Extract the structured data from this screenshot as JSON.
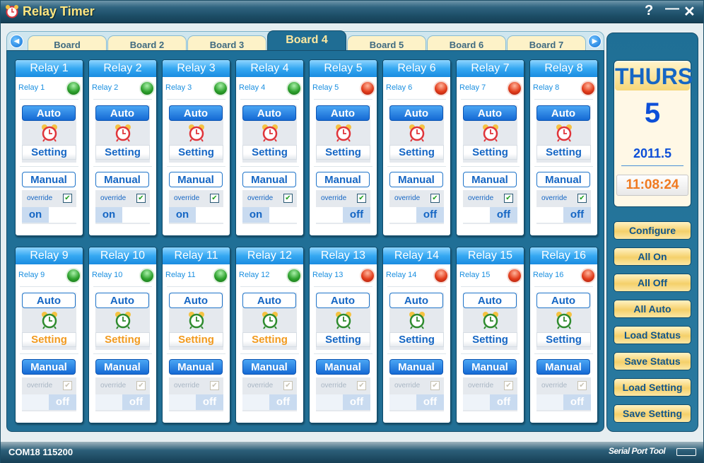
{
  "window": {
    "title": "Relay Timer",
    "controls": {
      "help": "?",
      "minimize": "—",
      "close": "✕"
    }
  },
  "tabs": {
    "prev_icon": "arrow-left-icon",
    "next_icon": "arrow-right-icon",
    "items": [
      {
        "label": "Board",
        "active": false
      },
      {
        "label": "Board 2",
        "active": false
      },
      {
        "label": "Board 3",
        "active": false
      },
      {
        "label": "Board 4",
        "active": true
      },
      {
        "label": "Board 5",
        "active": false
      },
      {
        "label": "Board 6",
        "active": false
      },
      {
        "label": "Board 7",
        "active": false
      }
    ]
  },
  "relays": [
    {
      "header": "Relay 1",
      "name": "Relay 1",
      "led": "green",
      "mode": "auto",
      "setting_color": "blue",
      "override": true,
      "state": "on"
    },
    {
      "header": "Relay 2",
      "name": "Relay 2",
      "led": "green",
      "mode": "auto",
      "setting_color": "blue",
      "override": true,
      "state": "on"
    },
    {
      "header": "Relay 3",
      "name": "Relay 3",
      "led": "green",
      "mode": "auto",
      "setting_color": "blue",
      "override": true,
      "state": "on"
    },
    {
      "header": "Relay 4",
      "name": "Relay 4",
      "led": "green",
      "mode": "auto",
      "setting_color": "blue",
      "override": true,
      "state": "on"
    },
    {
      "header": "Relay 5",
      "name": "Relay 5",
      "led": "red",
      "mode": "auto",
      "setting_color": "blue",
      "override": true,
      "state": "off"
    },
    {
      "header": "Relay 6",
      "name": "Relay 6",
      "led": "red",
      "mode": "auto",
      "setting_color": "blue",
      "override": true,
      "state": "off"
    },
    {
      "header": "Relay 7",
      "name": "Relay 7",
      "led": "red",
      "mode": "auto",
      "setting_color": "blue",
      "override": true,
      "state": "off"
    },
    {
      "header": "Relay 8",
      "name": "Relay 8",
      "led": "red",
      "mode": "auto",
      "setting_color": "blue",
      "override": true,
      "state": "off"
    },
    {
      "header": "Relay 9",
      "name": "Relay 9",
      "led": "green",
      "mode": "manual",
      "setting_color": "orange",
      "override": true,
      "state": "off"
    },
    {
      "header": "Relay 10",
      "name": "Relay 10",
      "led": "green",
      "mode": "manual",
      "setting_color": "orange",
      "override": true,
      "state": "off"
    },
    {
      "header": "Relay 11",
      "name": "Relay 11",
      "led": "green",
      "mode": "manual",
      "setting_color": "orange",
      "override": true,
      "state": "off"
    },
    {
      "header": "Relay 12",
      "name": "Relay 12",
      "led": "green",
      "mode": "manual",
      "setting_color": "orange",
      "override": true,
      "state": "off"
    },
    {
      "header": "Relay 13",
      "name": "Relay 13",
      "led": "red",
      "mode": "manual",
      "setting_color": "blue",
      "override": true,
      "state": "off"
    },
    {
      "header": "Relay 14",
      "name": "Relay 14",
      "led": "red",
      "mode": "manual",
      "setting_color": "blue",
      "override": true,
      "state": "off"
    },
    {
      "header": "Relay 15",
      "name": "Relay 15",
      "led": "red",
      "mode": "manual",
      "setting_color": "blue",
      "override": true,
      "state": "off"
    },
    {
      "header": "Relay 16",
      "name": "Relay 16",
      "led": "red",
      "mode": "manual",
      "setting_color": "blue",
      "override": true,
      "state": "off"
    }
  ],
  "relay_labels": {
    "auto": "Auto",
    "setting": "Setting",
    "manual": "Manual",
    "override": "override",
    "on": "on",
    "off": "off"
  },
  "calendar": {
    "weekday": "THURS",
    "day": "5",
    "year_month": "2011.5",
    "time": "11:08:24"
  },
  "side_buttons": [
    "Configure",
    "All On",
    "All Off",
    "All Auto",
    "Load Status",
    "Save Status",
    "Load Setting",
    "Save Setting"
  ],
  "statusbar": {
    "port": "COM18 115200",
    "brand": "Serial Port Tool"
  },
  "colors": {
    "accent_blue": "#1566c4",
    "led_green": "#2ea12e",
    "led_red": "#e23d1c",
    "setting_orange": "#f29a1e",
    "time_orange": "#f07a20",
    "panel_blue": "#1f6f96"
  }
}
